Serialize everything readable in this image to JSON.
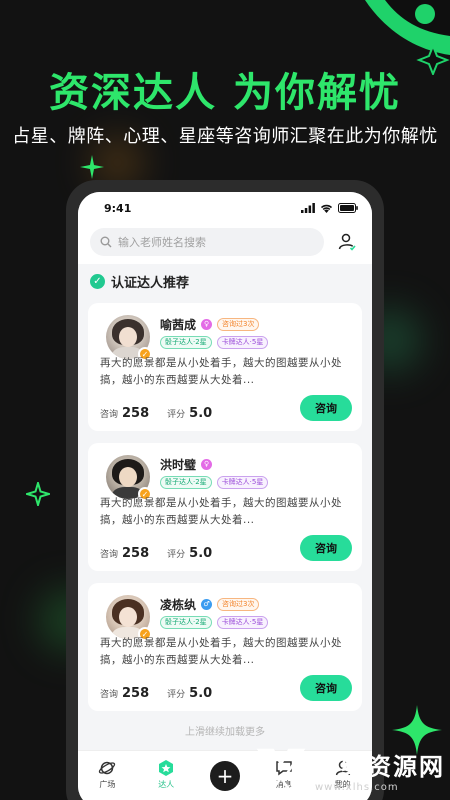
{
  "promo": {
    "title": "资深达人 为你解忧",
    "subtitle": "占星、牌阵、心理、星座等咨询师汇聚在此为你解忧"
  },
  "status_bar": {
    "time": "9:41"
  },
  "search": {
    "placeholder": "输入老师姓名搜索"
  },
  "section": {
    "title": "认证达人推荐",
    "badge_icon": "check-icon"
  },
  "experts": [
    {
      "name": "喻茜成",
      "gender_icon": "female-icon",
      "consulted_badge": "咨询过3次",
      "tags": [
        "骰子达人·2星",
        "卡牌达人·5星"
      ],
      "description": "再大的愿景都是从小处着手，越大的图越要从小处搞，越小的东西越要从大处着...",
      "consult_label": "咨询",
      "consult_count": "258",
      "rating_label": "评分",
      "rating": "5.0",
      "button_label": "咨询"
    },
    {
      "name": "洪时璧",
      "gender_icon": "female-icon",
      "consulted_badge": "",
      "tags": [
        "骰子达人·2星",
        "卡牌达人·5星"
      ],
      "description": "再大的愿景都是从小处着手，越大的图越要从小处搞，越小的东西越要从大处着...",
      "consult_label": "咨询",
      "consult_count": "258",
      "rating_label": "评分",
      "rating": "5.0",
      "button_label": "咨询"
    },
    {
      "name": "凌栋纨",
      "gender_icon": "male-icon",
      "consulted_badge": "咨询过3次",
      "tags": [
        "骰子达人·2星",
        "卡牌达人·5星"
      ],
      "description": "再大的愿景都是从小处着手，越大的图越要从小处搞，越小的东西越要从大处着...",
      "consult_label": "咨询",
      "consult_count": "258",
      "rating_label": "评分",
      "rating": "5.0",
      "button_label": "咨询"
    }
  ],
  "load_more": "上滑继续加载更多",
  "tabbar": {
    "items": [
      {
        "label": "广场",
        "icon": "planet-icon"
      },
      {
        "label": "达人",
        "icon": "star-badge-icon"
      },
      {
        "label": "",
        "icon": "plus-icon"
      },
      {
        "label": "消息",
        "icon": "message-icon"
      },
      {
        "label": "我的",
        "icon": "profile-icon"
      }
    ]
  },
  "watermark": {
    "title": "新绿资源网",
    "url": "www.xlhs.com"
  },
  "colors": {
    "accent": "#27dc9a",
    "promo_green": "#2ee66b",
    "background": "#121212"
  }
}
